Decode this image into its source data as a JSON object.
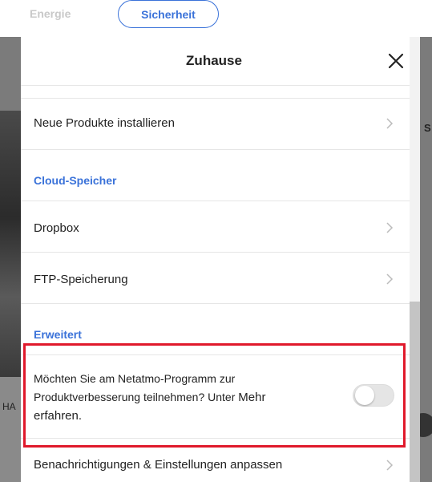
{
  "background": {
    "tabs": [
      {
        "label": "Energie"
      },
      {
        "label": "Sicherheit"
      }
    ],
    "left_label": "HA",
    "right_label": "S"
  },
  "modal": {
    "title": "Zuhause",
    "rows": [
      {
        "label": "Neue Produkte installieren"
      },
      {
        "section": "Cloud-Speicher"
      },
      {
        "label": "Dropbox"
      },
      {
        "label": "FTP-Speicherung"
      },
      {
        "section": "Erweitert"
      },
      {
        "label_part1": "Möchten Sie am Netatmo-Programm zur Produktverbesserung teilnehmen? Unter ",
        "label_part2": "Mehr erfahren."
      },
      {
        "label": "Benachrichtigungen & Einstellungen anpassen"
      }
    ],
    "toggle_on": false
  },
  "colors": {
    "accent": "#3a72d9",
    "highlight": "#e0192b"
  }
}
